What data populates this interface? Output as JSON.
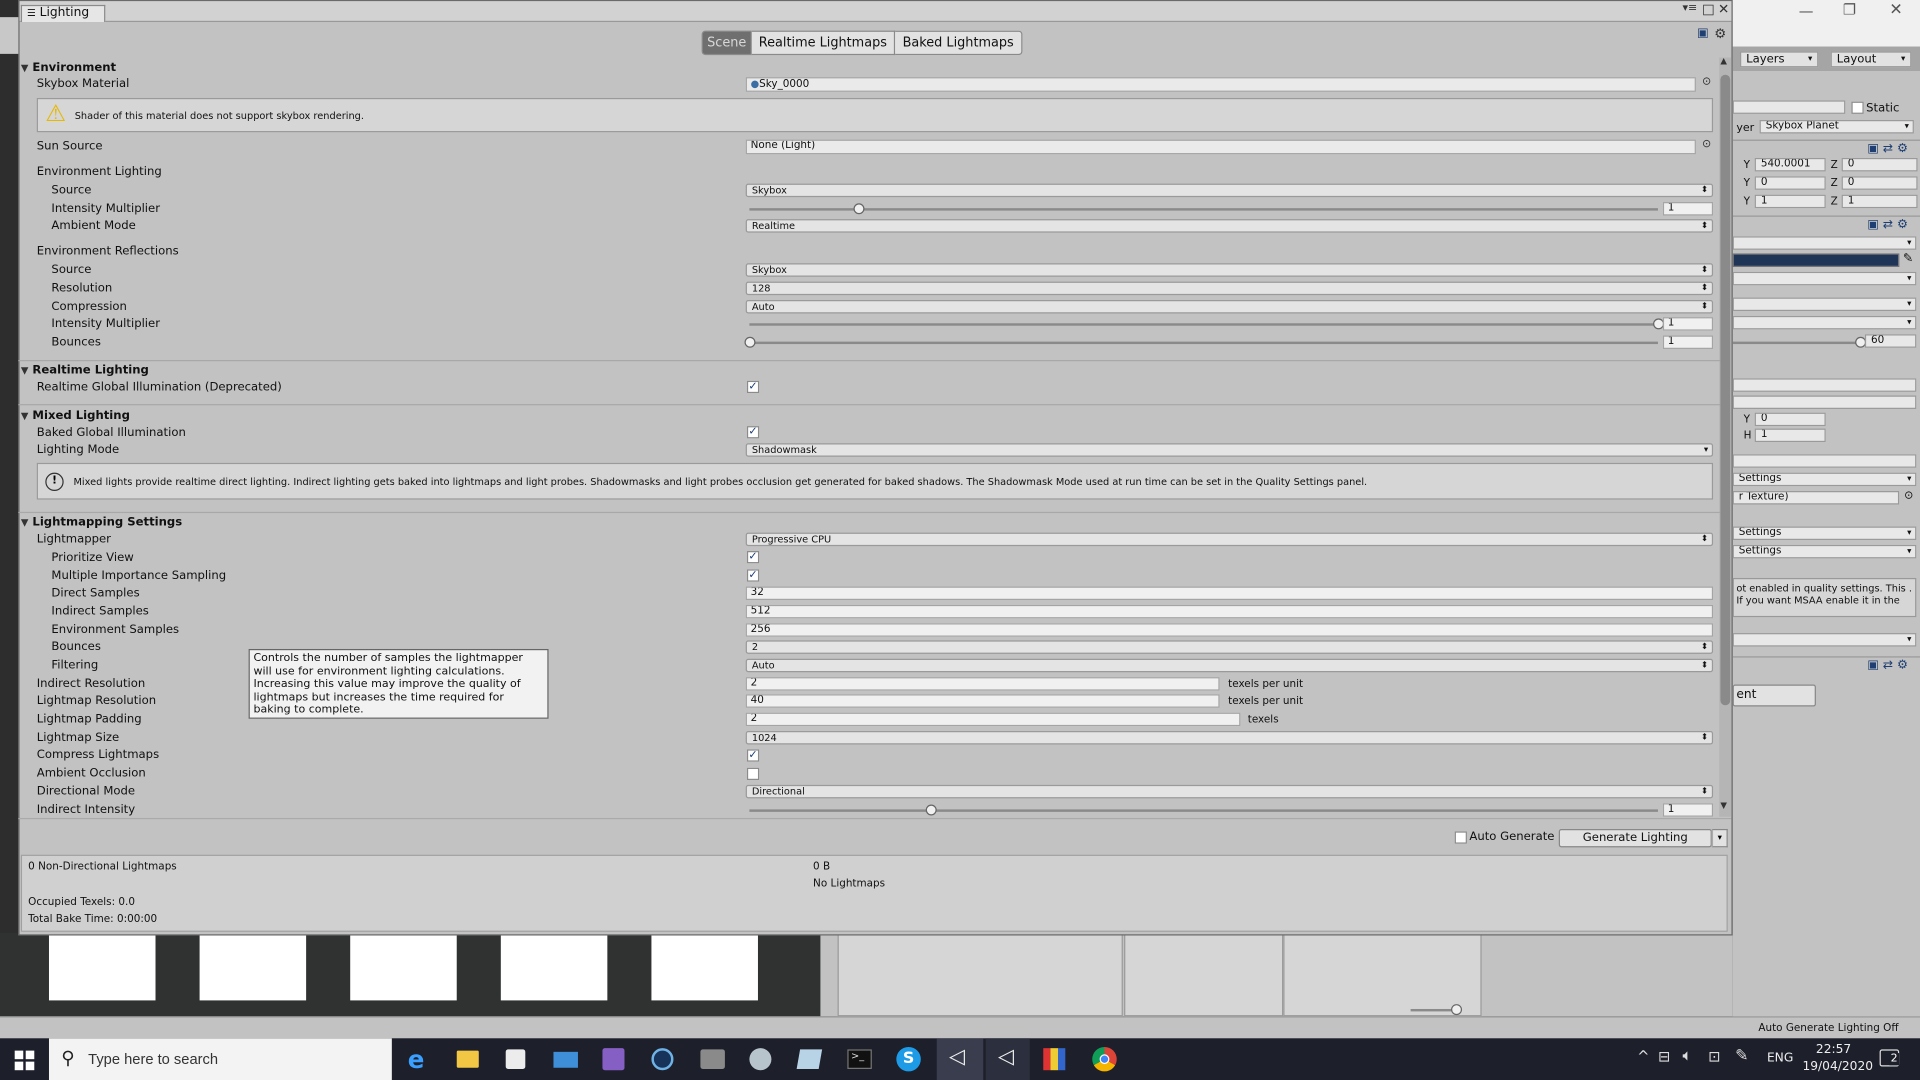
{
  "window": {
    "title": "Lighting"
  },
  "tabs": [
    {
      "label": "Scene"
    },
    {
      "label": "Realtime Lightmaps"
    },
    {
      "label": "Baked Lightmaps"
    }
  ],
  "environment": {
    "header": "Environment",
    "skybox_label": "Skybox Material",
    "skybox_value": "Sky_0000",
    "warning": "Shader of this material does not support skybox rendering.",
    "sun_label": "Sun Source",
    "sun_value": "None (Light)",
    "env_lighting_label": "Environment Lighting",
    "el_source_label": "Source",
    "el_source_value": "Skybox",
    "el_intensity_label": "Intensity Multiplier",
    "el_intensity_value": "1",
    "el_intensity_fraction": 0.12,
    "el_ambient_label": "Ambient Mode",
    "el_ambient_value": "Realtime",
    "env_reflections_label": "Environment Reflections",
    "er_source_label": "Source",
    "er_source_value": "Skybox",
    "er_resolution_label": "Resolution",
    "er_resolution_value": "128",
    "er_compression_label": "Compression",
    "er_compression_value": "Auto",
    "er_intensity_label": "Intensity Multiplier",
    "er_intensity_value": "1",
    "er_intensity_fraction": 1.0,
    "er_bounces_label": "Bounces",
    "er_bounces_value": "1",
    "er_bounces_fraction": 0.0
  },
  "realtime": {
    "header": "Realtime Lighting",
    "rgi_label": "Realtime Global Illumination (Deprecated)",
    "rgi_checked": true
  },
  "mixed": {
    "header": "Mixed Lighting",
    "bgi_label": "Baked Global Illumination",
    "bgi_checked": true,
    "mode_label": "Lighting Mode",
    "mode_value": "Shadowmask",
    "info": "Mixed lights provide realtime direct lighting. Indirect lighting gets baked into lightmaps and light probes. Shadowmasks and light probes occlusion get generated for baked shadows. The Shadowmask Mode used at run time can be set in the Quality Settings panel."
  },
  "lightmapping": {
    "header": "Lightmapping Settings",
    "lightmapper_label": "Lightmapper",
    "lightmapper_value": "Progressive CPU",
    "prioritize_label": "Prioritize View",
    "prioritize_checked": true,
    "mis_label": "Multiple Importance Sampling",
    "mis_checked": true,
    "direct_label": "Direct Samples",
    "direct_value": "32",
    "indirect_label": "Indirect Samples",
    "indirect_value": "512",
    "envsamples_label": "Environment Samples",
    "envsamples_value": "256",
    "bounces_label": "Bounces",
    "bounces_value": "2",
    "filtering_label": "Filtering",
    "filtering_value": "Auto",
    "indres_label": "Indirect Resolution",
    "indres_value": "2",
    "indres_unit": "texels per unit",
    "lmres_label": "Lightmap Resolution",
    "lmres_value": "40",
    "lmres_unit": "texels per unit",
    "padding_label": "Lightmap Padding",
    "padding_value": "2",
    "padding_unit": "texels",
    "size_label": "Lightmap Size",
    "size_value": "1024",
    "compress_label": "Compress Lightmaps",
    "compress_checked": true,
    "ao_label": "Ambient Occlusion",
    "ao_checked": false,
    "dirmode_label": "Directional Mode",
    "dirmode_value": "Directional",
    "indint_label": "Indirect Intensity",
    "indint_value": "1",
    "indint_fraction": 0.2
  },
  "tooltip": "Controls the number of samples the lightmapper will use for environment lighting calculations. Increasing this value may improve the quality of lightmaps but increases the time required for baking to complete.",
  "footer": {
    "auto_generate_label": "Auto Generate",
    "auto_generate_checked": false,
    "generate_label": "Generate Lighting"
  },
  "stats": {
    "lightmaps": "0 Non-Directional Lightmaps",
    "size": "0 B",
    "no_lightmaps": "No Lightmaps",
    "texels": "Occupied Texels: 0.0",
    "bake_time": "Total Bake Time: 0:00:00"
  },
  "editor": {
    "layers": "Layers",
    "layout": "Layout",
    "static": "Static",
    "layer_label": "yer",
    "layer_value": "Skybox Planet",
    "pos_y": "540.0001",
    "pos_z": "0",
    "rot_y": "0",
    "rot_z": "0",
    "scale_y": "1",
    "scale_z": "1",
    "fov": "60",
    "vp_y": "0",
    "vp_h": "1",
    "settings1": "Settings",
    "texture": "r Texture)",
    "settings2": "Settings",
    "settings3": "Settings",
    "msaa_text": "ot enabled in quality settings. This . If you want MSAA enable it in the",
    "button": "ent",
    "status": "Auto Generate Lighting Off"
  },
  "taskbar": {
    "search_placeholder": "Type here to search",
    "lang": "ENG",
    "time": "22:57",
    "date": "19/04/2020",
    "notifications": "2"
  },
  "colors": {
    "panel_bg": "#c2c2c2",
    "taskbar_bg": "#1d1f2b",
    "accent_blue": "#1f3f73"
  }
}
